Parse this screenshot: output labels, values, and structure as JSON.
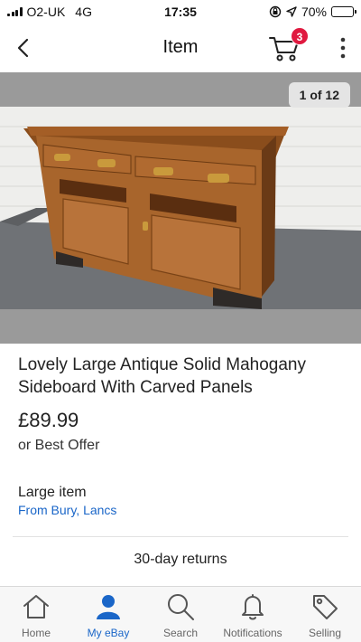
{
  "status_bar": {
    "carrier": "O2-UK",
    "network": "4G",
    "time": "17:35",
    "battery": "70%",
    "battery_level": 0.7,
    "icons": [
      "signal-icon",
      "orientation-lock-icon",
      "location-arrow-icon",
      "battery-icon"
    ]
  },
  "header": {
    "title": "Item",
    "cart_count": "3",
    "icons": [
      "back-chevron-icon",
      "cart-icon",
      "more-vertical-icon"
    ]
  },
  "gallery": {
    "counter": "1 of 12",
    "image_subject": "antique mahogany sideboard"
  },
  "listing": {
    "title": "Lovely Large Antique Solid Mahogany Sideboard With Carved Panels",
    "price": "£89.99",
    "offer": "or Best Offer",
    "size_note": "Large item",
    "location": "From Bury, Lancs",
    "returns": "30-day returns"
  },
  "tabs": [
    {
      "label": "Home",
      "icon": "home-icon",
      "active": false
    },
    {
      "label": "My eBay",
      "icon": "person-icon",
      "active": true
    },
    {
      "label": "Search",
      "icon": "search-icon",
      "active": false
    },
    {
      "label": "Notifications",
      "icon": "bell-icon",
      "active": false
    },
    {
      "label": "Selling",
      "icon": "tag-icon",
      "active": false
    }
  ],
  "colors": {
    "accent": "#1a66c8",
    "badge": "#e0193f",
    "gallery_bg": "#9a9a9a"
  }
}
